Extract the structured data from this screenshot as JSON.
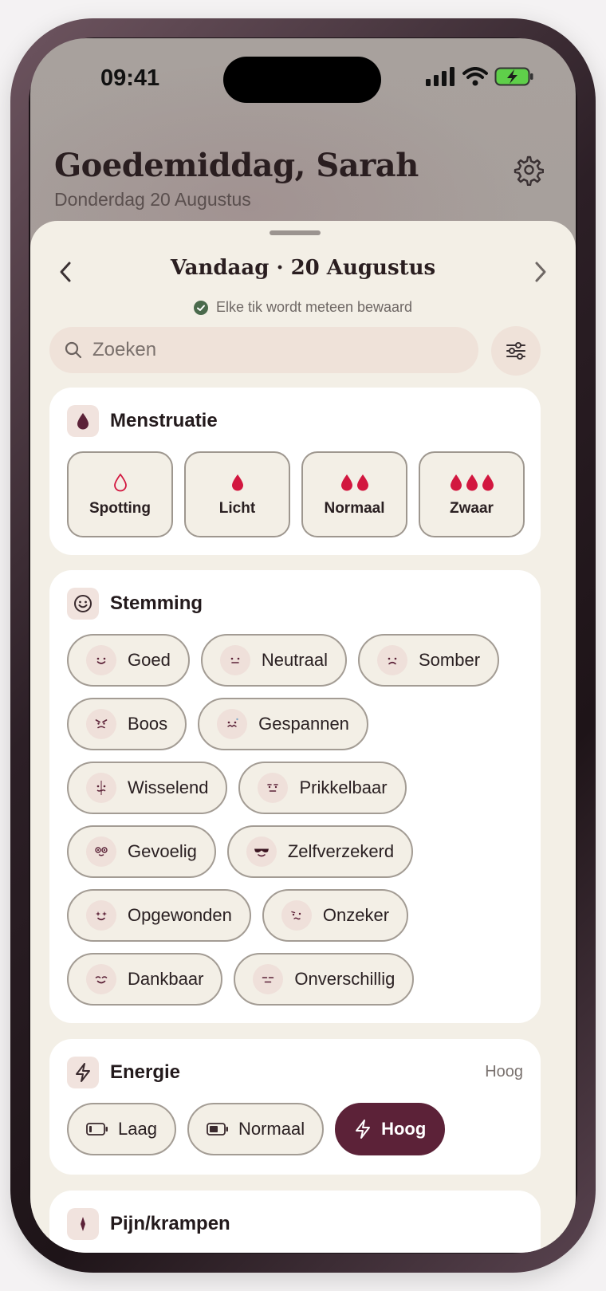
{
  "status_bar": {
    "time": "09:41"
  },
  "header": {
    "greeting": "Goedemiddag, Sarah",
    "date": "Donderdag 20 Augustus"
  },
  "sheet": {
    "day_title": "Vandaag · 20 Augustus",
    "save_note": "Elke tik wordt meteen bewaard",
    "search": {
      "placeholder": "Zoeken"
    }
  },
  "menstruatie": {
    "title": "Menstruatie",
    "options": [
      {
        "label": "Spotting",
        "drops": 1,
        "outline": true
      },
      {
        "label": "Licht",
        "drops": 1,
        "outline": false
      },
      {
        "label": "Normaal",
        "drops": 2,
        "outline": false
      },
      {
        "label": "Zwaar",
        "drops": 3,
        "outline": false
      }
    ]
  },
  "stemming": {
    "title": "Stemming",
    "moods": [
      {
        "label": "Goed",
        "icon": "smile-face-icon"
      },
      {
        "label": "Neutraal",
        "icon": "neutral-face-icon"
      },
      {
        "label": "Somber",
        "icon": "sad-face-icon"
      },
      {
        "label": "Boos",
        "icon": "angry-face-icon"
      },
      {
        "label": "Gespannen",
        "icon": "tense-face-icon"
      },
      {
        "label": "Wisselend",
        "icon": "split-face-icon"
      },
      {
        "label": "Prikkelbaar",
        "icon": "irritated-face-icon"
      },
      {
        "label": "Gevoelig",
        "icon": "teary-face-icon"
      },
      {
        "label": "Zelfverzekerd",
        "icon": "sunglasses-face-icon"
      },
      {
        "label": "Opgewonden",
        "icon": "sparkle-eyes-face-icon"
      },
      {
        "label": "Onzeker",
        "icon": "unsure-face-icon"
      },
      {
        "label": "Dankbaar",
        "icon": "content-face-icon"
      },
      {
        "label": "Onverschillig",
        "icon": "indifferent-face-icon"
      }
    ]
  },
  "energie": {
    "title": "Energie",
    "selected_value": "Hoog",
    "options": [
      {
        "label": "Laag",
        "icon": "battery-low-icon"
      },
      {
        "label": "Normaal",
        "icon": "battery-mid-icon"
      },
      {
        "label": "Hoog",
        "icon": "lightning-icon",
        "active": true
      }
    ]
  },
  "pijn": {
    "title": "Pijn/krampen"
  },
  "colors": {
    "accent": "#5c2238",
    "drop": "#d2173f",
    "sheet": "#f3efe6",
    "check": "#4a6a4c"
  }
}
